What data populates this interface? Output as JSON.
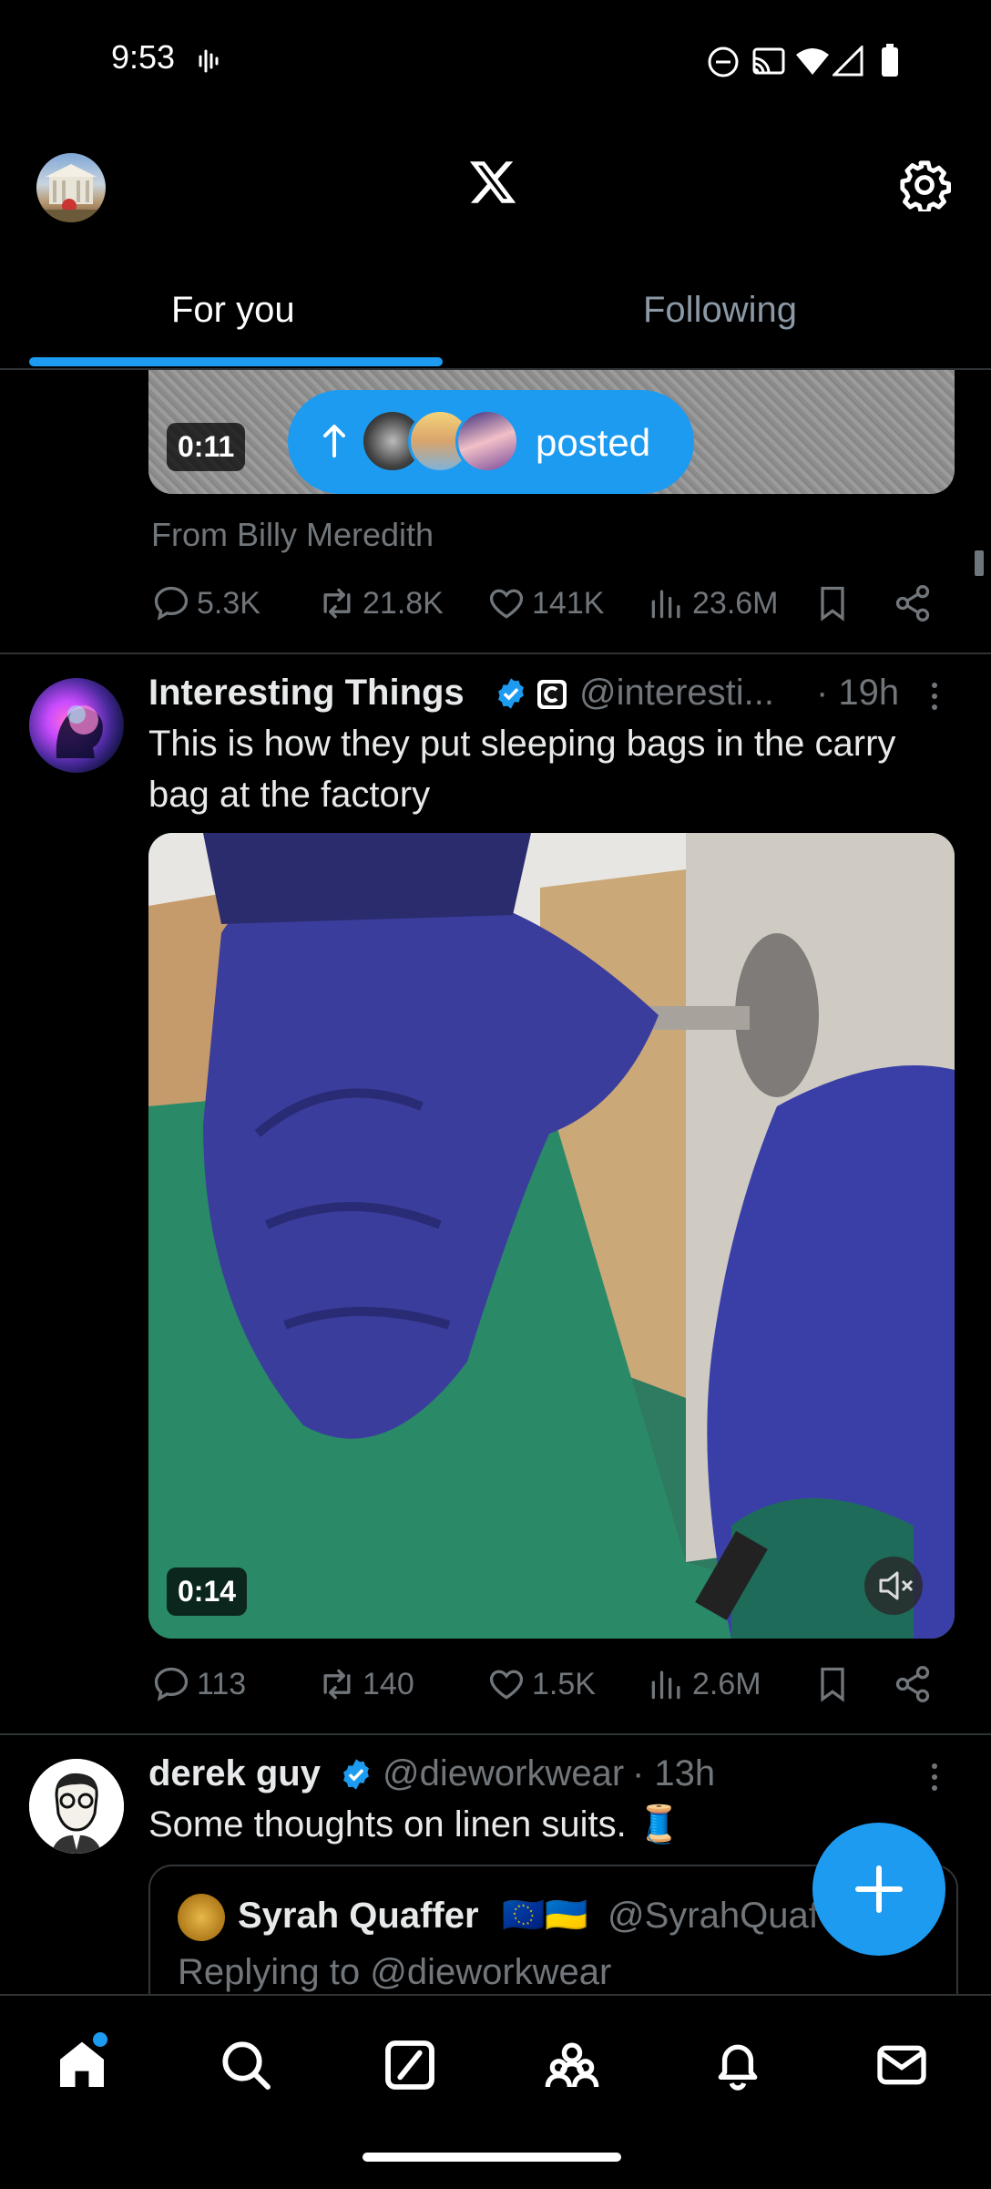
{
  "status_bar": {
    "time": "9:53"
  },
  "header": {
    "logo": "x-logo-icon",
    "settings_icon": "gear-icon"
  },
  "tabs": [
    {
      "label": "For you",
      "active": true
    },
    {
      "label": "Following",
      "active": false
    }
  ],
  "post1": {
    "video_duration": "0:11",
    "posted_pill_label": "posted",
    "from_label": "From Billy Meredith",
    "stats": {
      "replies": "5.3K",
      "reposts": "21.8K",
      "likes": "141K",
      "views": "23.6M"
    }
  },
  "post2": {
    "author": "Interesting Things",
    "handle": "@interesti...",
    "time": "· 19h",
    "text_line1": "This is how they put sleeping bags in the carry",
    "text_line2": "bag at the factory",
    "video_duration": "0:14",
    "stats": {
      "replies": "113",
      "reposts": "140",
      "likes": "1.5K",
      "views": "2.6M"
    }
  },
  "post3": {
    "author": "derek guy",
    "handle": "@dieworkwear",
    "time": "· 13h",
    "text": "Some thoughts on linen suits. 🧵",
    "quote": {
      "author": "Syrah Quaffer",
      "flags": "🇪🇺🇺🇦",
      "handle": "@SyrahQuaf",
      "replying": "Replying to @dieworkwear"
    }
  },
  "colors": {
    "accent": "#1d9bf0",
    "background": "#000000",
    "muted": "#71767b"
  },
  "bottom_nav": [
    "home-icon",
    "search-icon",
    "grok-icon",
    "communities-icon",
    "notifications-icon",
    "messages-icon"
  ]
}
